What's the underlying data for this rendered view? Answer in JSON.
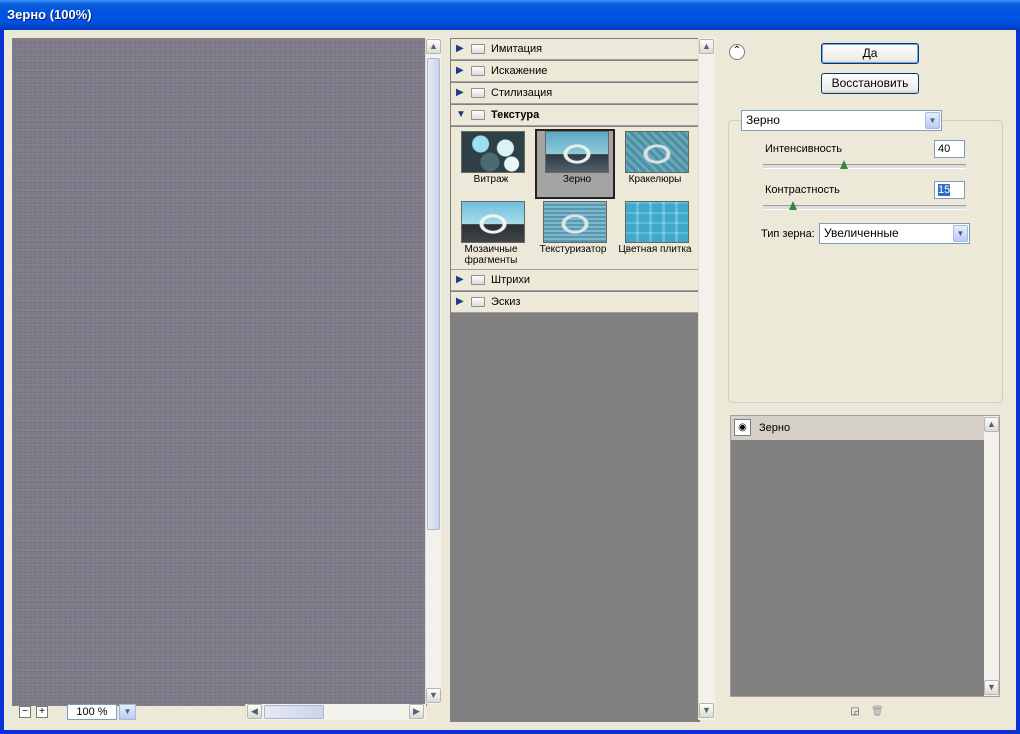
{
  "window": {
    "title": "Зерно (100%)"
  },
  "preview": {
    "zoom": "100 %",
    "zoom_out_label": "−",
    "zoom_in_label": "+"
  },
  "gallery": {
    "categories_top": [
      {
        "label": "Имитация"
      },
      {
        "label": "Искажение"
      },
      {
        "label": "Стилизация"
      }
    ],
    "open_category": "Текстура",
    "thumbnails": [
      {
        "label": "Витраж"
      },
      {
        "label": "Зерно",
        "selected": true
      },
      {
        "label": "Кракелюры"
      },
      {
        "label": "Мозаичные фрагменты"
      },
      {
        "label": "Текстуризатор"
      },
      {
        "label": "Цветная плитка"
      }
    ],
    "categories_bottom": [
      {
        "label": "Штрихи"
      },
      {
        "label": "Эскиз"
      }
    ]
  },
  "buttons": {
    "ok": "Да",
    "reset": "Восстановить"
  },
  "filter": {
    "selected": "Зерно",
    "intensity_label": "Интенсивность",
    "intensity_value": "40",
    "intensity_fraction": 0.4,
    "contrast_label": "Контрастность",
    "contrast_value": "15",
    "contrast_fraction": 0.15,
    "grain_type_label": "Тип зерна:",
    "grain_type_value": "Увеличенные"
  },
  "layers": [
    {
      "name": "Зерно"
    }
  ],
  "icons": [
    "collapse-icon",
    "eye-icon",
    "new-layer-icon",
    "delete-layer-icon",
    "expand-triangle-icon",
    "collapse-triangle-icon",
    "folder-icon"
  ]
}
